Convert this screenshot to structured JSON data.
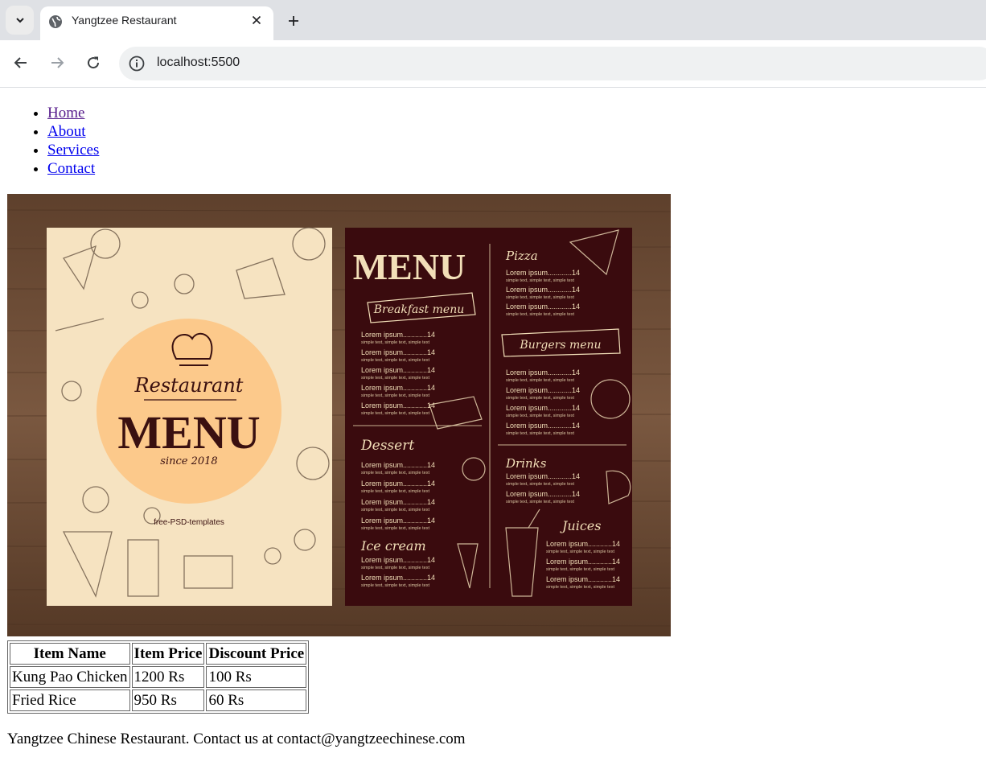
{
  "browser": {
    "tab_title": "Yangtzee Restaurant",
    "url": "localhost:5500"
  },
  "nav": {
    "items": [
      {
        "label": "Home",
        "visited": true
      },
      {
        "label": "About",
        "visited": false
      },
      {
        "label": "Services",
        "visited": false
      },
      {
        "label": "Contact",
        "visited": false
      }
    ]
  },
  "menu_image": {
    "left_panel": {
      "heading": "Restaurant",
      "title": "MENU",
      "since": "since 2018",
      "brand": "free-PSD-templates"
    },
    "right_panel": {
      "title": "MENU",
      "item_line": "Lorem ipsum............14",
      "sub_line": "simple text, simple text, simple text",
      "sections": {
        "breakfast": "Breakfast menu",
        "pizza": "Pizza",
        "burgers": "Burgers menu",
        "dessert": "Dessert",
        "drinks": "Drinks",
        "ice_cream": "Ice cream",
        "juices": "Juices"
      }
    }
  },
  "table": {
    "headers": [
      "Item Name",
      "Item Price",
      "Discount Price"
    ],
    "rows": [
      [
        "Kung Pao Chicken",
        "1200 Rs",
        "100 Rs"
      ],
      [
        "Fried Rice",
        "950 Rs",
        "60 Rs"
      ]
    ]
  },
  "footer": {
    "text": "Yangtzee Chinese Restaurant. Contact us at contact@yangtzeechinese.com"
  },
  "colors": {
    "tabbar": "#dfe1e5",
    "omnibox": "#eff1f2",
    "link": "#0000ee",
    "link_visited": "#551a8b",
    "menu_cream": "#f6e3c1",
    "menu_peach": "#fcc98b",
    "menu_dark": "#3a0b0e",
    "menu_wood": "#6b4a34"
  }
}
